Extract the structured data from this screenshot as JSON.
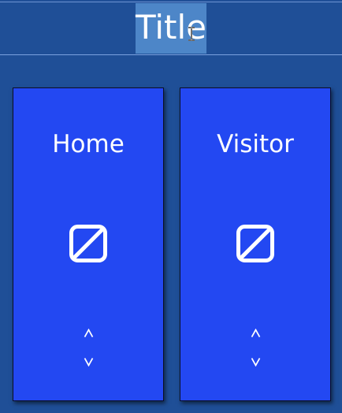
{
  "header": {
    "title": "Title"
  },
  "teams": [
    {
      "label": "Home",
      "icon": "pencil-square-icon",
      "up_icon": "chevron-up-icon",
      "down_icon": "chevron-down-icon"
    },
    {
      "label": "Visitor",
      "icon": "pencil-square-icon",
      "up_icon": "chevron-up-icon",
      "down_icon": "chevron-down-icon"
    }
  ],
  "colors": {
    "background": "#1f4f97",
    "card": "#2348f2",
    "title_selection": "#4d86c8",
    "text": "#ffffff"
  }
}
